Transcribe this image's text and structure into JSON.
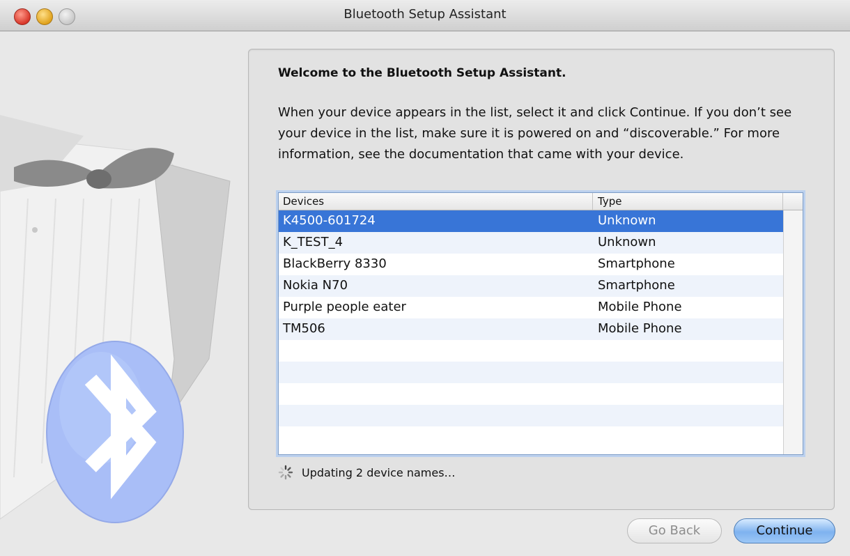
{
  "window": {
    "title": "Bluetooth Setup Assistant"
  },
  "panel": {
    "heading": "Welcome to the Bluetooth Setup Assistant.",
    "paragraph": "When your device appears in the list, select it and click Continue. If you don’t see your device in the list, make sure it is powered on and “discoverable.” For more information, see the documentation that came with your device."
  },
  "device_list": {
    "columns": [
      "Devices",
      "Type"
    ],
    "rows": [
      {
        "name": "K4500-601724",
        "type": "Unknown",
        "selected": true
      },
      {
        "name": "K_TEST_4",
        "type": "Unknown",
        "selected": false
      },
      {
        "name": "BlackBerry 8330",
        "type": "Smartphone",
        "selected": false
      },
      {
        "name": "Nokia N70",
        "type": "Smartphone",
        "selected": false
      },
      {
        "name": "Purple people eater",
        "type": "Mobile Phone",
        "selected": false
      },
      {
        "name": "TM506",
        "type": "Mobile Phone",
        "selected": false
      },
      {
        "name": "",
        "type": "",
        "selected": false
      },
      {
        "name": "",
        "type": "",
        "selected": false
      },
      {
        "name": "",
        "type": "",
        "selected": false
      },
      {
        "name": "",
        "type": "",
        "selected": false
      },
      {
        "name": "",
        "type": "",
        "selected": false
      }
    ]
  },
  "status": {
    "text": "Updating 2 device names…",
    "icon": "spinner-icon"
  },
  "buttons": {
    "go_back": "Go Back",
    "continue": "Continue"
  },
  "colors": {
    "selection": "#3875d7",
    "accent_button": "#7fb2ef"
  }
}
